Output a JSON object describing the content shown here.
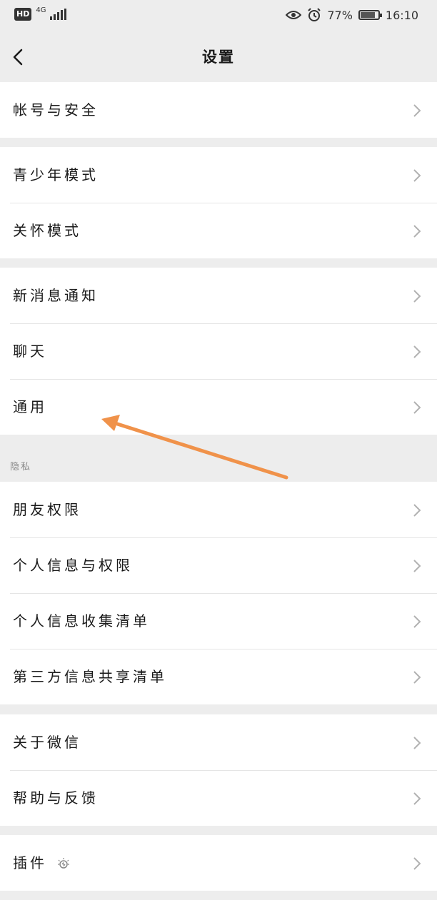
{
  "status_bar": {
    "hd": "HD",
    "network": "4G",
    "battery": "77%",
    "time": "16:10"
  },
  "nav": {
    "title": "设置"
  },
  "groups": [
    {
      "rows": [
        {
          "label": "帐号与安全"
        }
      ]
    },
    {
      "rows": [
        {
          "label": "青少年模式"
        },
        {
          "label": "关怀模式"
        }
      ]
    },
    {
      "rows": [
        {
          "label": "新消息通知"
        },
        {
          "label": "聊天"
        },
        {
          "label": "通用"
        }
      ]
    },
    {
      "header": "隐私",
      "rows": [
        {
          "label": "朋友权限"
        },
        {
          "label": "个人信息与权限"
        },
        {
          "label": "个人信息收集清单"
        },
        {
          "label": "第三方信息共享清单"
        }
      ]
    },
    {
      "rows": [
        {
          "label": "关于微信"
        },
        {
          "label": "帮助与反馈"
        }
      ]
    },
    {
      "rows": [
        {
          "label": "插件"
        }
      ]
    }
  ],
  "colors": {
    "background": "#ededed",
    "row_background": "#ffffff",
    "annotation_arrow": "#f0924a"
  }
}
